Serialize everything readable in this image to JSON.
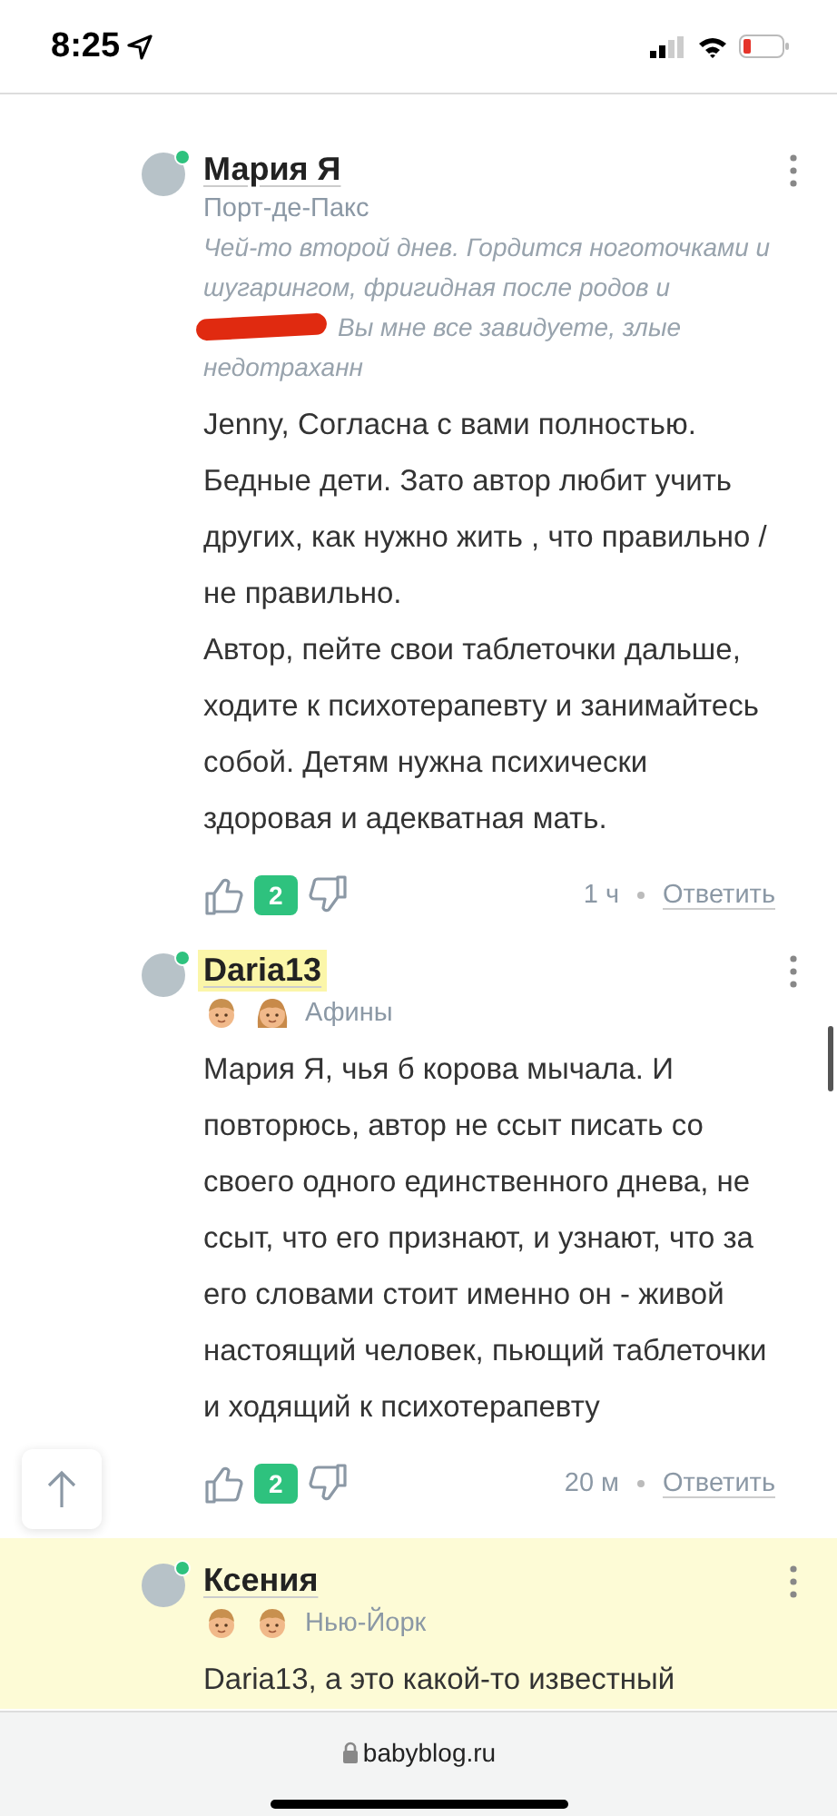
{
  "status_bar": {
    "time": "8:25"
  },
  "comments": [
    {
      "author": "Мария Я",
      "online": true,
      "name_highlighted": false,
      "highlighted": false,
      "location": "Порт-де-Пакс",
      "signature": {
        "before": "Чей-то второй днев. Гордится ноготочками и шугарингом, фригидная после родов и",
        "after": [
          "Вы мне все завидуете, злые",
          "недотраханн"
        ]
      },
      "body": [
        "Jenny, Согласна с вами полностью. Бедные дети. Зато автор любит учить других, как нужно жить , что правильно /не правильно.",
        "Автор, пейте свои таблеточки дальше, ходите к психотерапевту и занимайтесь собой. Детям нужна психически здоровая и адекватная мать."
      ],
      "votes": "2",
      "time": "1 ч",
      "reply": "Ответить"
    },
    {
      "author": "Daria13",
      "online": true,
      "name_highlighted": true,
      "highlighted": false,
      "kids": [
        {
          "kind": "boy"
        },
        {
          "kind": "girl"
        }
      ],
      "location": "Афины",
      "body": [
        "Мария Я, чья б корова мычала. И повторюсь, автор не ссыт писать со своего одного единственного днева, не ссыт, что его признают, и узнают, что за его словами стоит именно он - живой настоящий человек, пьющий таблеточки и ходящий к психотерапевту"
      ],
      "votes": "2",
      "time": "20 м",
      "reply": "Ответить"
    },
    {
      "author": "Ксения",
      "online": true,
      "name_highlighted": false,
      "highlighted": true,
      "kids": [
        {
          "kind": "boy"
        },
        {
          "kind": "boy"
        }
      ],
      "location": "Нью-Йорк",
      "body": [
        "Daria13, а это какой-то известный"
      ]
    }
  ],
  "browser_bar": {
    "url": "babyblog.ru"
  }
}
